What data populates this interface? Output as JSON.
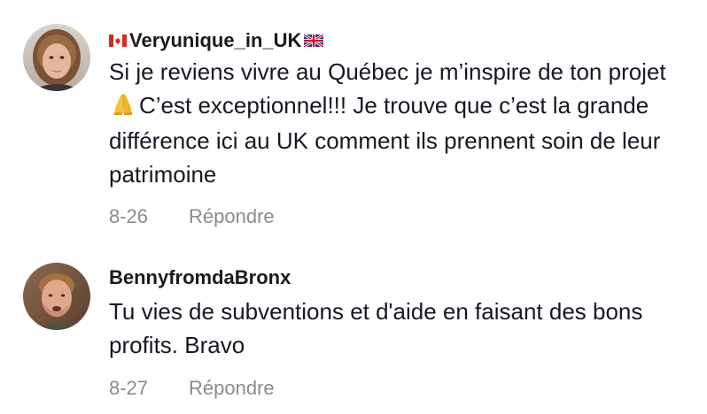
{
  "comments": [
    {
      "username": "Veryunique_in_UK",
      "username_prefix_icon": "canada-flag-icon",
      "username_suffix_icon": "uk-flag-icon",
      "text_part1": "Si je reviens vivre au Québec je m’inspire de ton projet",
      "inline_emoji": "folded-hands-icon",
      "text_part2": "C’est exceptionnel!!! Je trouve que c’est la grande différence ici au UK comment ils prennent soin de leur patrimoine",
      "date": "8-26",
      "reply_label": "Répondre"
    },
    {
      "username": "BennyfromdaBronx",
      "text": "Tu vies de subventions et d'aide en faisant des bons profits. Bravo",
      "date": "8-27",
      "reply_label": "Répondre"
    }
  ],
  "colors": {
    "username": "#1a1a1a",
    "text": "#161823",
    "meta": "#8a8b91",
    "background": "#ffffff"
  }
}
